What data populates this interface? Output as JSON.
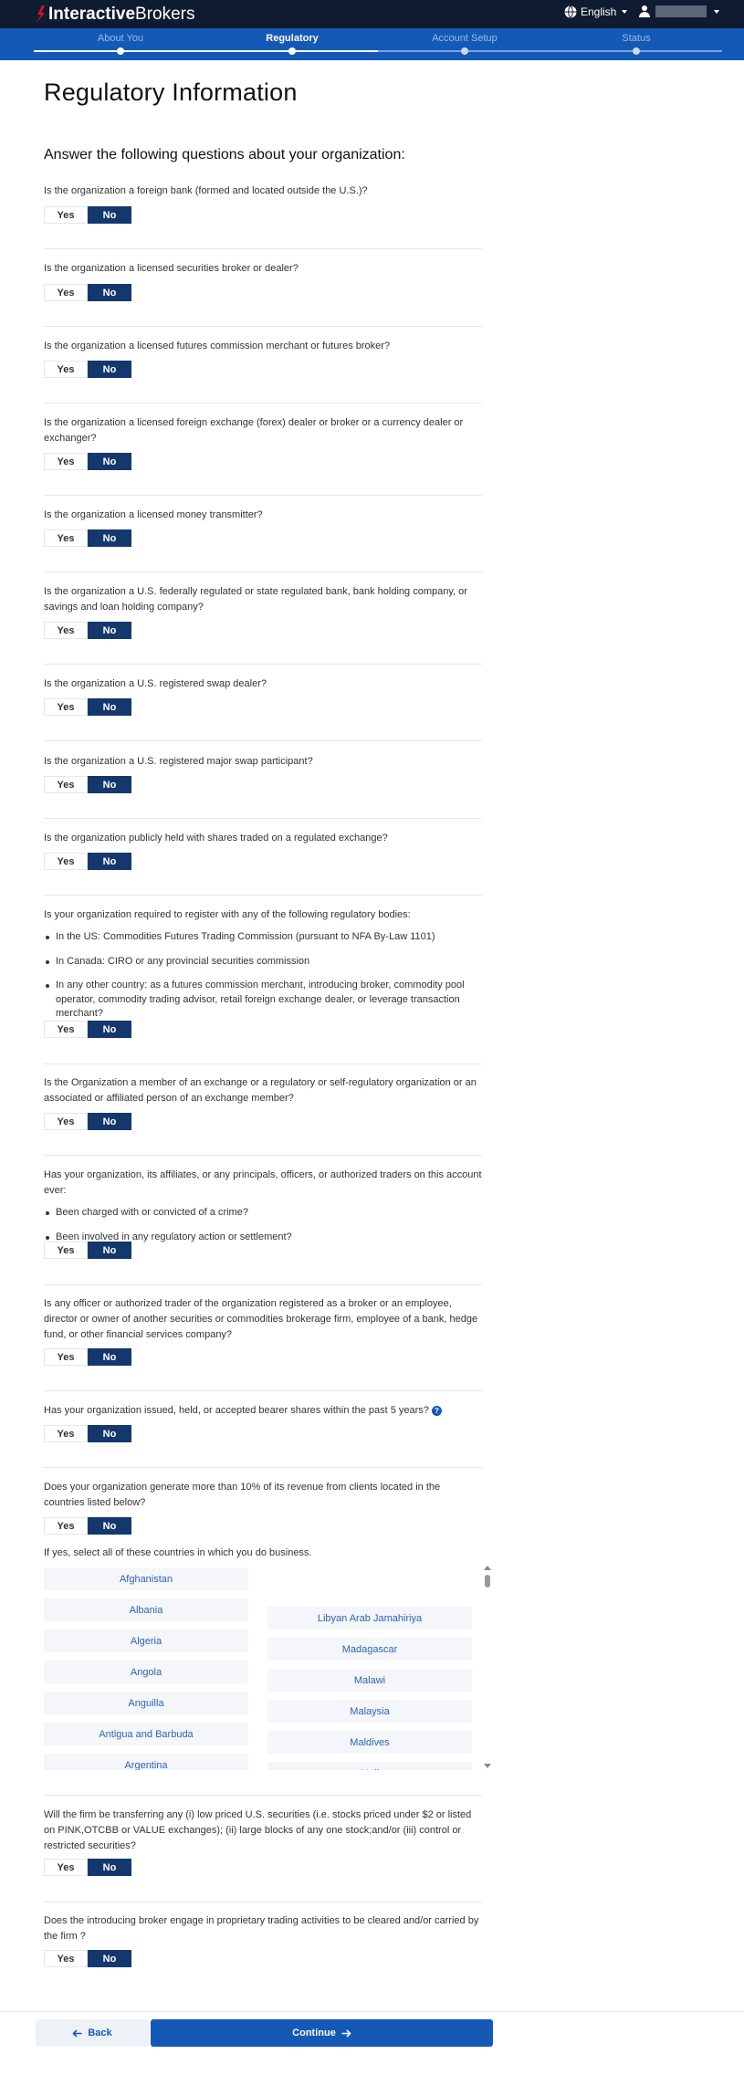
{
  "header": {
    "brand_bold": "Interactive",
    "brand_regular": "Brokers",
    "language": "English"
  },
  "steps": [
    {
      "label": "About You",
      "state": "done"
    },
    {
      "label": "Regulatory",
      "state": "active"
    },
    {
      "label": "Account Setup",
      "state": "pending"
    },
    {
      "label": "Status",
      "state": "pending"
    }
  ],
  "page": {
    "title": "Regulatory Information",
    "subtitle": "Answer the following questions about your organization:"
  },
  "options": {
    "yes": "Yes",
    "no": "No"
  },
  "questions": [
    {
      "text": "Is the organization a foreign bank (formed and located outside the U.S.)?",
      "selected": "No"
    },
    {
      "text": "Is the organization a licensed securities broker or dealer?",
      "selected": "No"
    },
    {
      "text": "Is the organization a licensed futures commission merchant or futures broker?",
      "selected": "No"
    },
    {
      "text": "Is the organization a licensed foreign exchange (forex) dealer or broker or a currency dealer or exchanger?",
      "selected": "No"
    },
    {
      "text": "Is the organization a licensed money transmitter?",
      "selected": "No"
    },
    {
      "text": "Is the organization a U.S. federally regulated or state regulated bank, bank holding company, or savings and loan holding company?",
      "selected": "No"
    },
    {
      "text": "Is the organization a U.S. registered swap dealer?",
      "selected": "No"
    },
    {
      "text": "Is the organization a U.S. registered major swap participant?",
      "selected": "No"
    },
    {
      "text": "Is the organization publicly held with shares traded on a regulated exchange?",
      "selected": "No"
    },
    {
      "text": "Is your organization required to register with any of the following regulatory bodies:",
      "bullets": [
        "In the US: Commodities Futures Trading Commission (pursuant to NFA By-Law 1101)",
        "In Canada: CIRO or any provincial securities commission",
        "In any other country: as a futures commission merchant, introducing broker, commodity pool operator, commodity trading advisor, retail foreign exchange dealer, or leverage transaction merchant?"
      ],
      "selected": "No"
    },
    {
      "text": "Is the Organization a member of an exchange or a regulatory or self-regulatory organization or an associated or affiliated person of an exchange member?",
      "selected": "No"
    },
    {
      "text": "Has your organization, its affiliates, or any principals, officers, or authorized traders on this account ever:",
      "bullets": [
        "Been charged with or convicted of a crime?",
        "Been involved in any regulatory action or settlement?"
      ],
      "selected": "No"
    },
    {
      "text": "Is any officer or authorized trader of the organization registered as a broker or an employee, director or owner of another securities or commodities brokerage firm, employee of a bank, hedge fund, or other financial services company?",
      "selected": "No"
    },
    {
      "text": "Has your organization issued, held, or accepted bearer shares within the past 5 years?",
      "selected": "No"
    },
    {
      "text": "Does your organization generate more than 10% of its revenue from clients located in the countries listed below?",
      "selected": "No"
    },
    {
      "text": "Will the firm be transferring any (i) low priced U.S. securities (i.e. stocks priced under $2 or listed on PINK,OTCBB or VALUE exchanges); (ii) large blocks of any one stock;and/or (iii) control or restricted securities?",
      "selected": "No"
    },
    {
      "text": "Does the introducing broker engage in proprietary trading activities to be cleared and/or carried by the firm ?",
      "selected": "No"
    }
  ],
  "countries": {
    "prompt": "If yes, select all of these countries in which you do business.",
    "left": [
      "Afghanistan",
      "Albania",
      "Algeria",
      "Angola",
      "Anguilla",
      "Antigua and Barbuda",
      "Argentina"
    ],
    "right": [
      "Libyan Arab Jamahiriya",
      "Madagascar",
      "Malawi",
      "Malaysia",
      "Maldives",
      "Mali"
    ]
  },
  "footer": {
    "back": "Back",
    "continue": "Continue"
  }
}
